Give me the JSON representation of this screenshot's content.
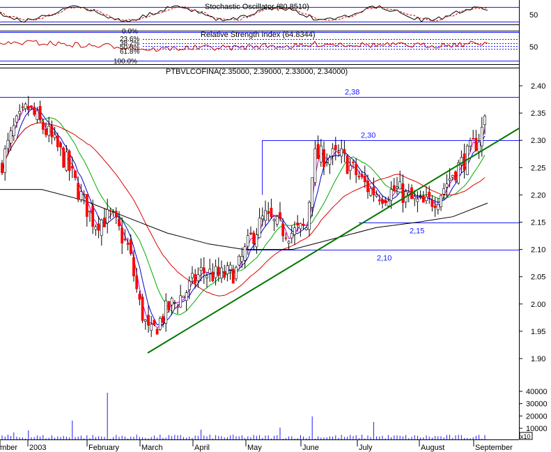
{
  "chart_data": [
    {
      "type": "line",
      "panel": "stochastic",
      "title": "Stochastic Oscillator (80.8510)",
      "value": 80.851,
      "y_ticks": [
        "50"
      ],
      "colors": {
        "k": "#000000",
        "d": "#cc0000",
        "band": "#1a1aff"
      }
    },
    {
      "type": "line",
      "panel": "rsi",
      "title": "Relative Strength Index (64.8344)",
      "value": 64.8344,
      "y_ticks": [
        "50"
      ],
      "fib_labels": [
        "0.0%",
        "23.6%",
        "38.2%",
        "50.0%",
        "61.8%",
        "100.0%"
      ],
      "colors": {
        "line": "#cc0000",
        "levels": "#1a1aff"
      }
    },
    {
      "type": "candlestick",
      "panel": "price",
      "title": "PTBVLCOFINA(2.35000, 2.39000, 2.33000, 2.34000)",
      "last_ohlc": {
        "open": 2.35,
        "high": 2.39,
        "low": 2.33,
        "close": 2.34
      },
      "ylim": [
        1.88,
        2.42
      ],
      "y_ticks": [
        "2.40",
        "2.35",
        "2.30",
        "2.25",
        "2.20",
        "2.15",
        "2.10",
        "2.05",
        "2.00",
        "1.95",
        "1.90"
      ],
      "x_ticks": [
        "mber",
        "2003",
        "February",
        "March",
        "April",
        "May",
        "June",
        "July",
        "August",
        "September"
      ],
      "levels": [
        {
          "label": "2,38",
          "value": 2.38
        },
        {
          "label": "2,30",
          "value": 2.3
        },
        {
          "label": "2,15",
          "value": 2.15
        },
        {
          "label": "2,10",
          "value": 2.1
        }
      ],
      "trendline": {
        "from": [
          "March",
          1.91
        ],
        "to": [
          "September",
          2.32
        ]
      },
      "colors": {
        "up": "#ffffff",
        "down": "#ff0000",
        "ma_fast": "#cc00cc",
        "ma_mid": "#0000cc",
        "ma_green": "#00aa00",
        "ma_red": "#dd0000",
        "ma_long": "#000000",
        "trend": "#007700",
        "level": "#1a1aff"
      }
    },
    {
      "type": "bar",
      "panel": "volume",
      "y_ticks": [
        "40000",
        "30000",
        "20000",
        "10000"
      ],
      "unit_label": "x10",
      "colors": {
        "bar": "#1a1aff"
      }
    }
  ]
}
